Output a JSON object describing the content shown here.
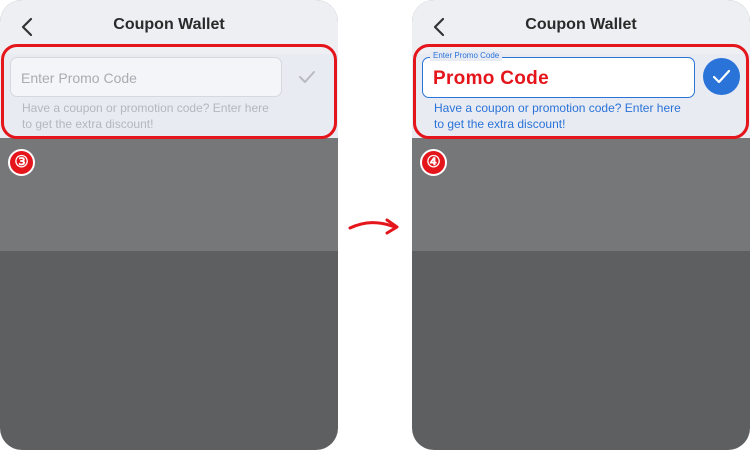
{
  "left_screen": {
    "title": "Coupon Wallet",
    "input_placeholder": "Enter Promo Code",
    "hint": "Have a coupon or promotion code? Enter here to get the extra discount!",
    "step_badge": "③"
  },
  "right_screen": {
    "title": "Coupon Wallet",
    "input_label": "Enter Promo Code",
    "input_value": "Promo Code",
    "hint": "Have a coupon or promotion code? Enter here to get the extra discount!",
    "step_badge": "④"
  },
  "icons": {
    "back": "chevron-left-icon",
    "submit_disabled": "check-icon",
    "submit_active": "check-circle-icon",
    "transition": "curved-arrow-right-icon"
  },
  "colors": {
    "highlight": "#e4151b",
    "accent_blue": "#2a73d8",
    "overlay_dark": "#5e5f61"
  }
}
